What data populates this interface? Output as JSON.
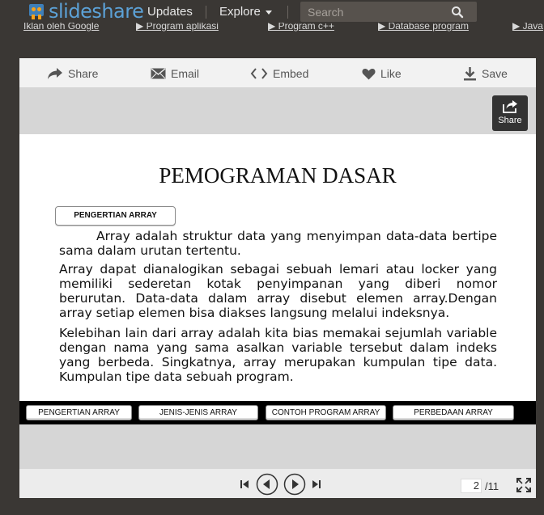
{
  "nav": {
    "logo_text": "slideshare",
    "updates": "Updates",
    "explore": "Explore",
    "search_placeholder": "Search"
  },
  "ad_links": [
    "Iklan oleh Google",
    "▶ Program aplikasi",
    "▶ Program c++",
    "▶ Database program",
    "▶ Java"
  ],
  "toolbar": {
    "share": "Share",
    "email": "Email",
    "embed": "Embed",
    "like": "Like",
    "save": "Save"
  },
  "share_float_label": "Share",
  "slide": {
    "title": "PEMOGRAMAN DASAR",
    "section_label": "PENGERTIAN ARRAY",
    "paragraphs": [
      "Array adalah struktur data yang menyimpan data-data bertipe sama dalam urutan tertentu.",
      "Array dapat dianalogikan sebagai sebuah lemari atau locker yang memiliki sederetan kotak penyimpanan yang diberi nomor berurutan. Data-data dalam array disebut elemen array.Dengan array setiap elemen bisa diakses langsung melalui indeksnya.",
      "Kelebihan lain dari array adalah kita bias memakai sejumlah variable dengan nama yang sama asalkan variable tersebut dalam indeks yang berbeda. Singkatnya, array merupakan kumpulan tipe data. Kumpulan tipe data sebuah program."
    ],
    "tabs": [
      "PENGERTIAN ARRAY",
      "JENIS-JENIS ARRAY",
      "CONTOH PROGRAM ARRAY",
      "PERBEDAAN ARRAY"
    ]
  },
  "pager": {
    "current": "2",
    "total": "/11"
  },
  "colors": {
    "nav_bg": "#3a3734",
    "logo_blue": "#5ca1d6",
    "logo_orange": "#f7a21b"
  }
}
